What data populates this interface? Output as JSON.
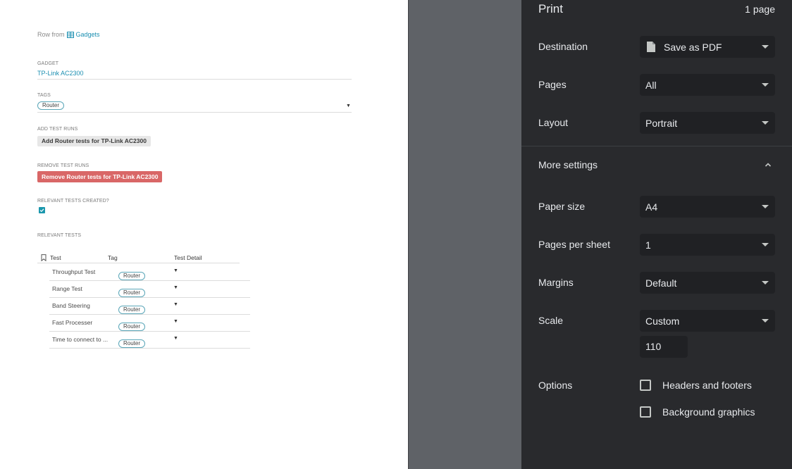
{
  "preview": {
    "row_from_label": "Row from",
    "row_from_table": "Gadgets",
    "gadget_label": "GADGET",
    "gadget_value": "TP-Link AC2300",
    "tags_label": "TAGS",
    "tags_value": "Router",
    "add_runs_label": "ADD TEST RUNS",
    "add_runs_button": "Add Router tests for TP-Link AC2300",
    "remove_runs_label": "REMOVE TEST RUNS",
    "remove_runs_button": "Remove Router tests for TP-Link AC2300",
    "created_label": "RELEVANT TESTS CREATED?",
    "created_checked": true,
    "relevant_label": "RELEVANT TESTS",
    "table": {
      "headers": [
        "Test",
        "Tag",
        "Test Detail"
      ],
      "rows": [
        {
          "test": "Throughput Test",
          "tag": "Router"
        },
        {
          "test": "Range Test",
          "tag": "Router"
        },
        {
          "test": "Band Steering",
          "tag": "Router"
        },
        {
          "test": "Fast Processer",
          "tag": "Router"
        },
        {
          "test": "Time to connect to ...",
          "tag": "Router"
        }
      ]
    }
  },
  "print": {
    "title": "Print",
    "page_count": "1 page",
    "destination_label": "Destination",
    "destination_value": "Save as PDF",
    "pages_label": "Pages",
    "pages_value": "All",
    "layout_label": "Layout",
    "layout_value": "Portrait",
    "more_settings_label": "More settings",
    "paper_size_label": "Paper size",
    "paper_size_value": "A4",
    "pages_per_sheet_label": "Pages per sheet",
    "pages_per_sheet_value": "1",
    "margins_label": "Margins",
    "margins_value": "Default",
    "scale_label": "Scale",
    "scale_value": "Custom",
    "scale_custom_value": "110",
    "options_label": "Options",
    "headers_footers_label": "Headers and footers",
    "headers_footers_checked": false,
    "background_graphics_label": "Background graphics",
    "background_graphics_checked": false
  },
  "colors": {
    "accent": "#1a97ad",
    "danger": "#d96767",
    "panel_bg": "#292a2d",
    "select_bg": "#202124"
  }
}
